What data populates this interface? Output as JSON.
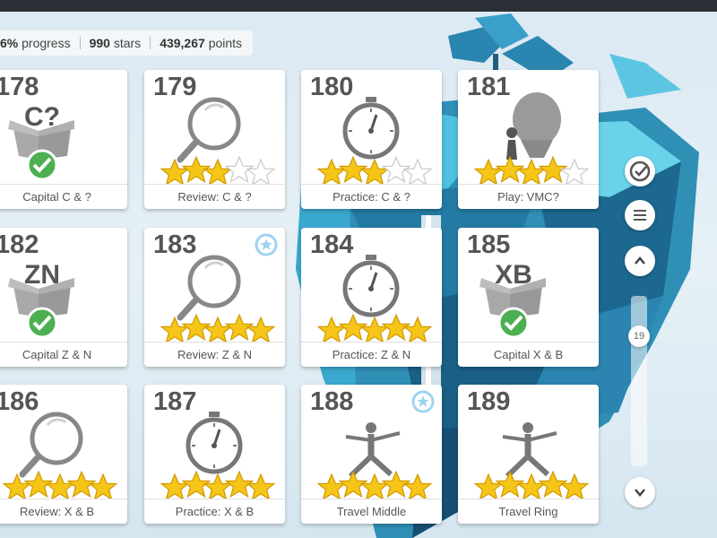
{
  "stats": {
    "progress": "6%",
    "progress_label": "progress",
    "stars": "990",
    "stars_label": "stars",
    "points": "439,267",
    "points_label": "points"
  },
  "lessons": [
    {
      "num": "178",
      "label": "Capital C & ?",
      "type": "box",
      "letters": "C?"
    },
    {
      "num": "179",
      "label": "Review: C & ?",
      "type": "review",
      "stars": 3
    },
    {
      "num": "180",
      "label": "Practice: C & ?",
      "type": "practice",
      "stars": 3
    },
    {
      "num": "181",
      "label": "Play: VMC?",
      "type": "play",
      "stars": 4
    },
    {
      "num": "182",
      "label": "Capital Z & N",
      "type": "box",
      "letters": "ZN"
    },
    {
      "num": "183",
      "label": "Review: Z & N",
      "type": "review",
      "stars": 5
    },
    {
      "num": "184",
      "label": "Practice: Z & N",
      "type": "practice",
      "stars": 5
    },
    {
      "num": "185",
      "label": "Capital X & B",
      "type": "box",
      "letters": "XB"
    },
    {
      "num": "186",
      "label": "Review: X & B",
      "type": "review",
      "stars": 5
    },
    {
      "num": "187",
      "label": "Practice: X & B",
      "type": "practice",
      "stars": 5
    },
    {
      "num": "188",
      "label": "Travel Middle",
      "type": "travel",
      "stars": 5
    },
    {
      "num": "189",
      "label": "Travel Ring",
      "type": "travel",
      "stars": 5
    }
  ],
  "scroll": {
    "position": "19"
  },
  "icons": {
    "check": "check-circle-icon",
    "menu": "hamburger-menu-icon",
    "up": "chevron-up-icon",
    "down": "chevron-down-icon",
    "badge": "laurel-star-badge-icon"
  },
  "colors": {
    "star": "#f5c518",
    "check": "#4caf50",
    "badge": "#9fd3f0"
  }
}
